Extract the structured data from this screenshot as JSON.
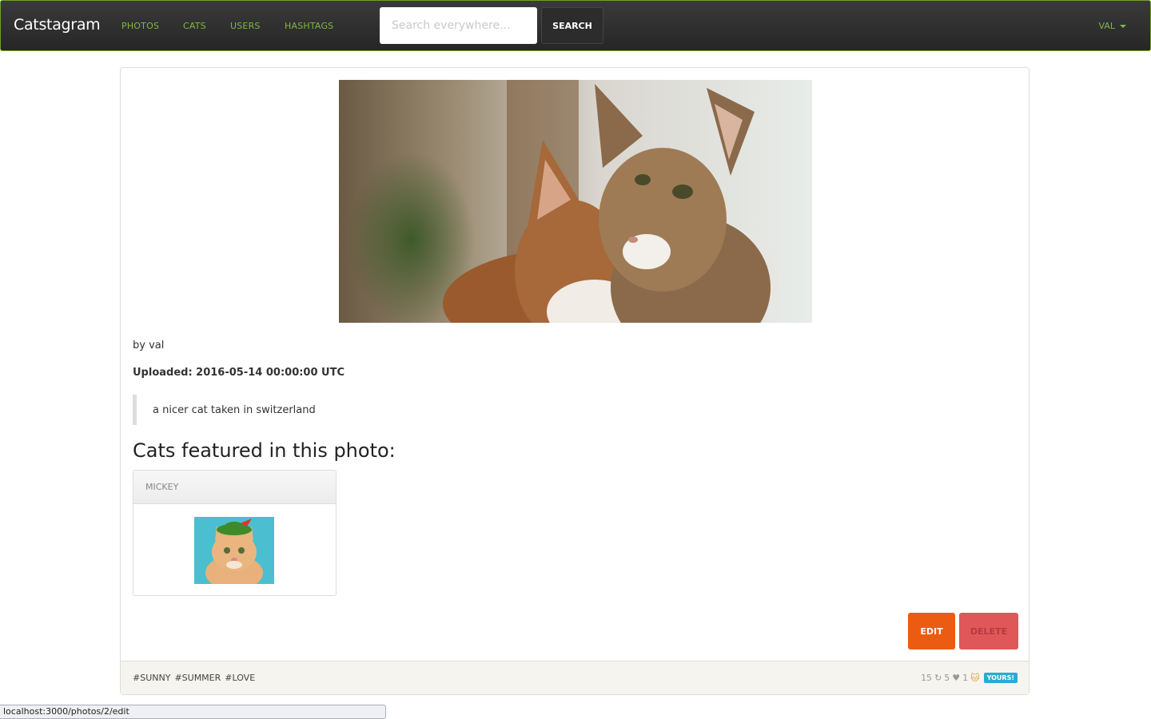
{
  "navbar": {
    "brand": "Catstagram",
    "links": [
      "PHOTOS",
      "CATS",
      "USERS",
      "HASHTAGS"
    ],
    "search_placeholder": "Search everywhere...",
    "search_label": "SEARCH",
    "user_label": "VAL"
  },
  "photo": {
    "byline": "by val",
    "uploaded": "Uploaded: 2016-05-14 00:00:00 UTC",
    "caption": "a nicer cat taken in switzerland",
    "cats_heading": "Cats featured in this photo:",
    "cats": [
      {
        "name": "MICKEY"
      }
    ]
  },
  "actions": {
    "edit": "EDIT",
    "delete": "DELETE"
  },
  "footer": {
    "tags": [
      "#SUNNY",
      "#SUMMER",
      "#LOVE"
    ],
    "views": "15",
    "reposts": "5",
    "likes": "1",
    "badge": "YOURS!"
  },
  "status_bar": {
    "url": "localhost:3000/photos/2/edit"
  },
  "colors": {
    "accent": "#7fb93a",
    "edit": "#ec5b12",
    "delete": "#e0575a",
    "badge": "#2aabd2"
  }
}
